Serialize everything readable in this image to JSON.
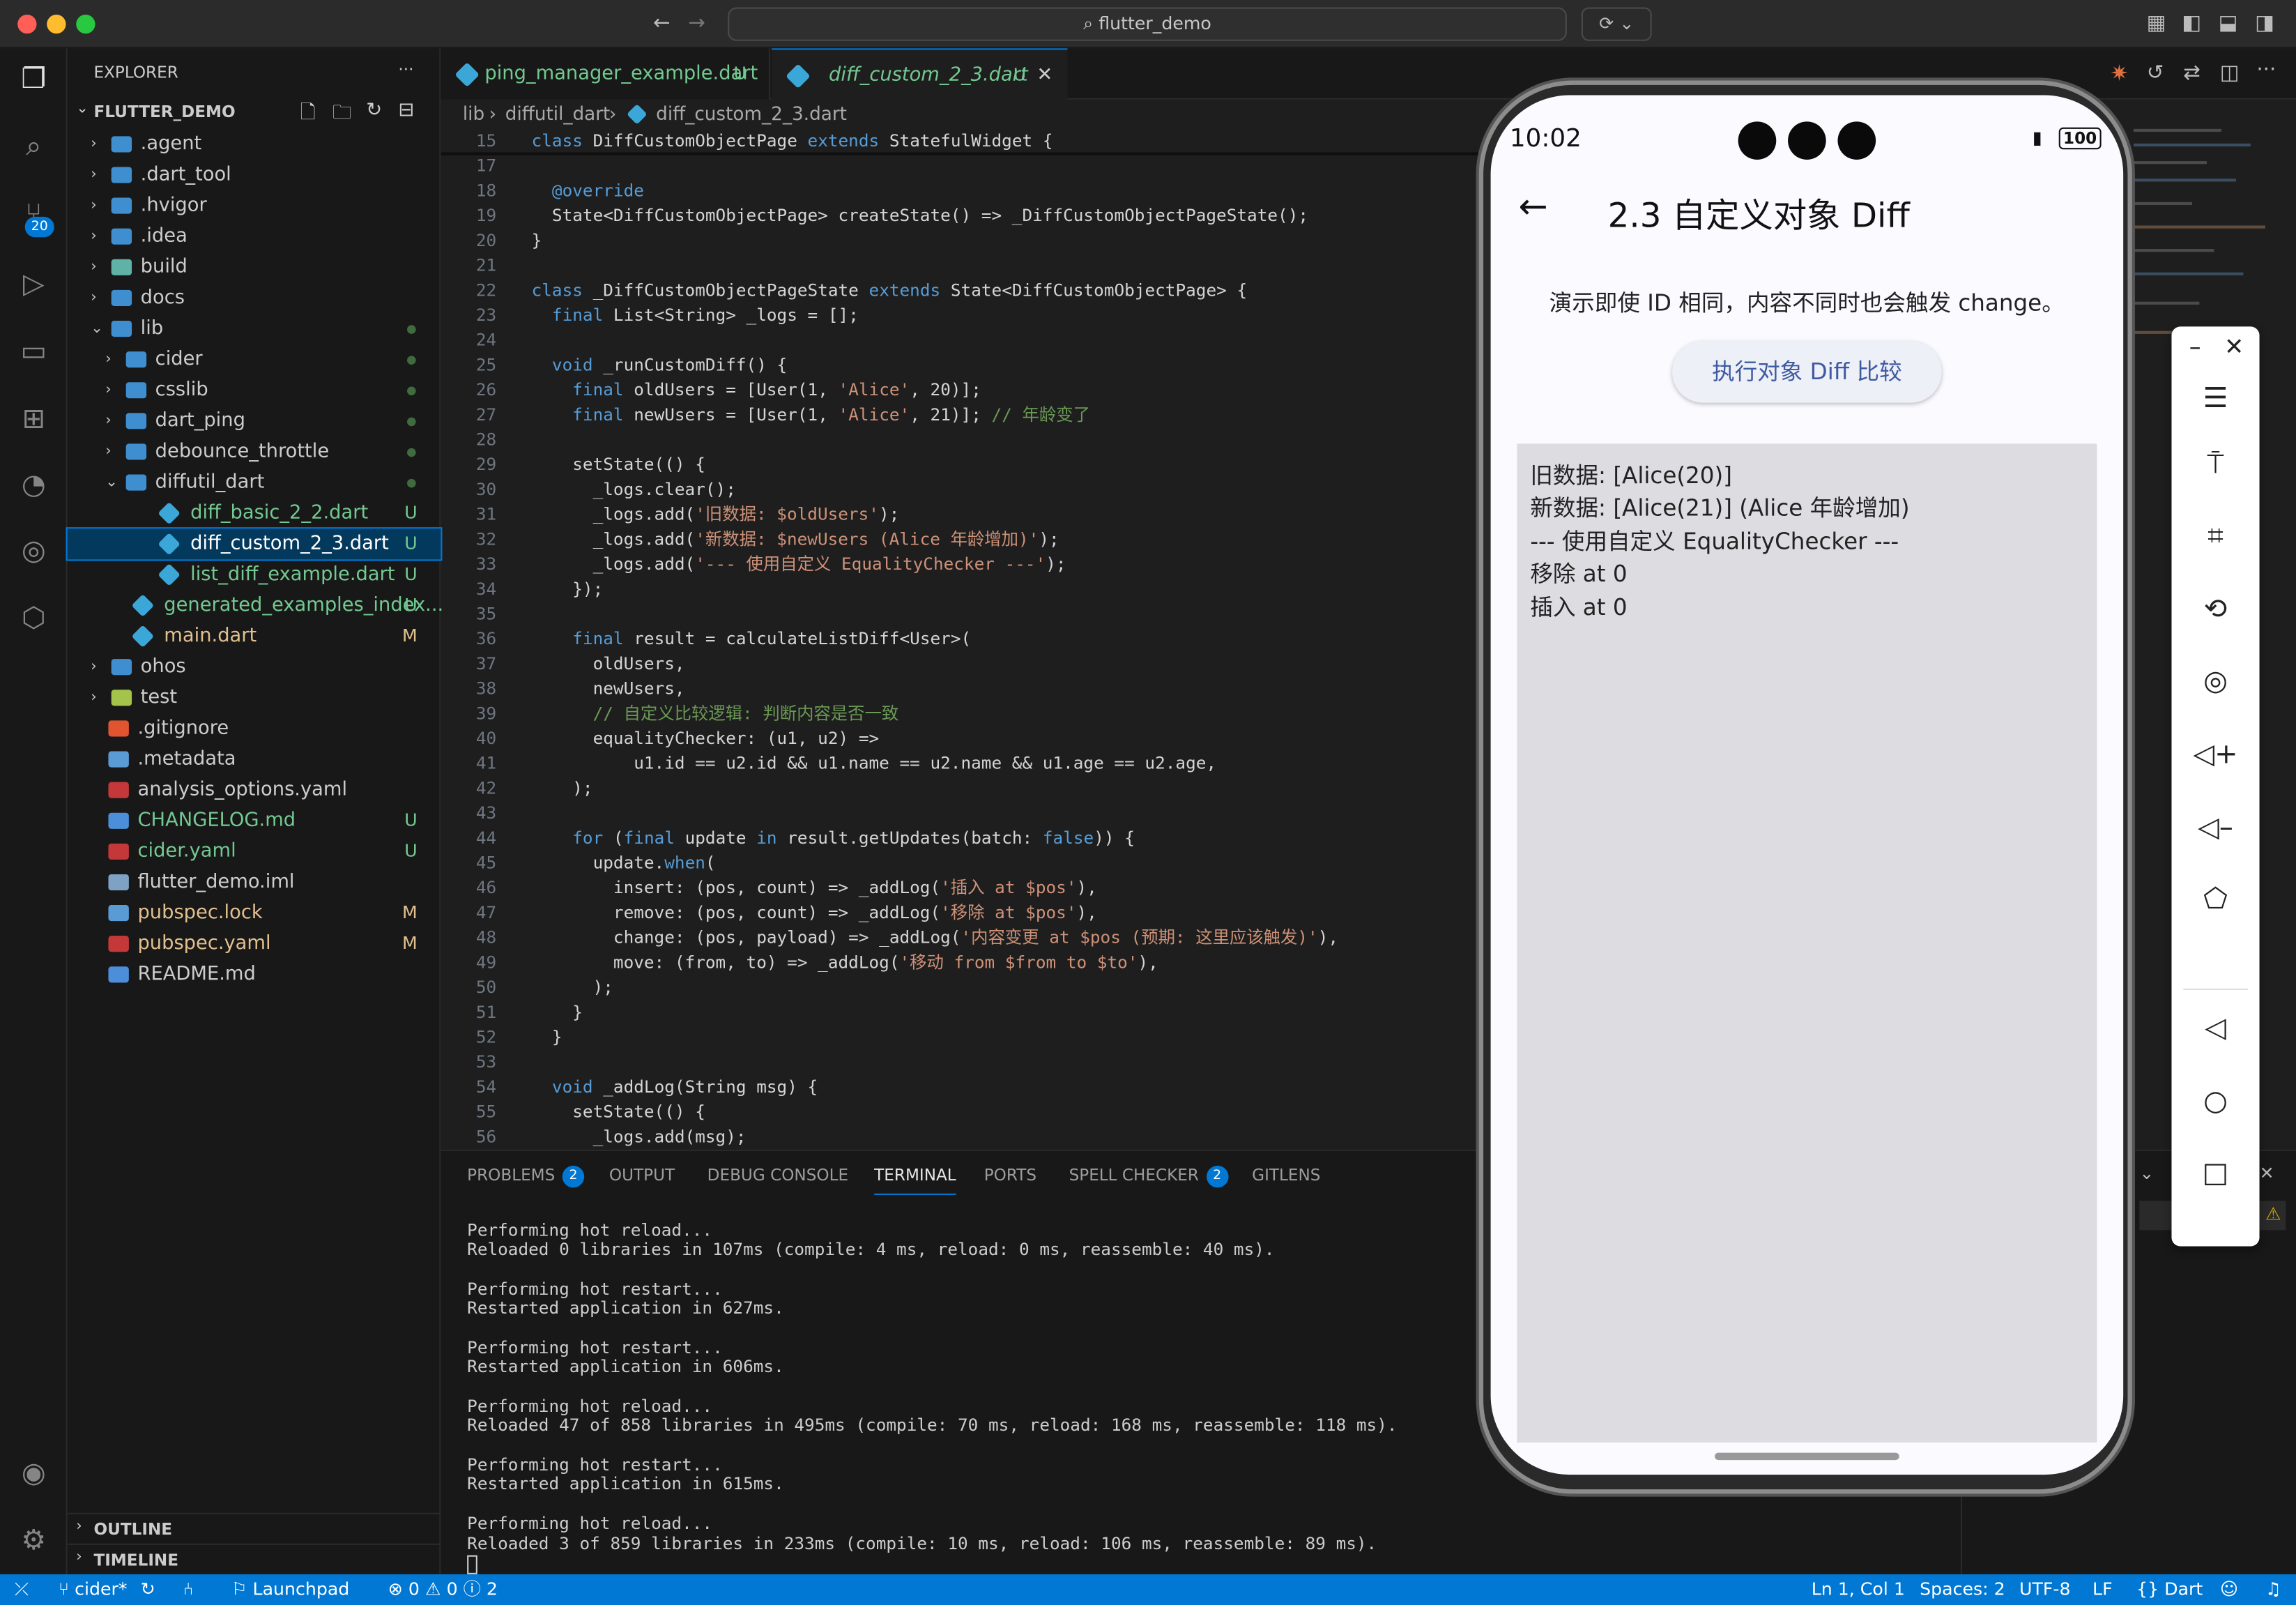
{
  "window": {
    "search_text": "flutter_demo"
  },
  "activity_bar": {
    "scm_badge": "20"
  },
  "explorer": {
    "title": "EXPLORER",
    "more": "···",
    "project": "FLUTTER_DEMO",
    "items": [
      {
        "label": ".agent",
        "type": "folder",
        "depth": 0,
        "open": false,
        "status": "",
        "dot": false
      },
      {
        "label": ".dart_tool",
        "type": "folder",
        "depth": 0,
        "open": false,
        "status": "",
        "dot": false
      },
      {
        "label": ".hvigor",
        "type": "folder",
        "depth": 0,
        "open": false,
        "status": "",
        "dot": false
      },
      {
        "label": ".idea",
        "type": "folder",
        "depth": 0,
        "open": false,
        "status": "",
        "dot": false
      },
      {
        "label": "build",
        "type": "folder-special",
        "depth": 0,
        "open": false,
        "status": "",
        "dot": false
      },
      {
        "label": "docs",
        "type": "folder",
        "depth": 0,
        "open": false,
        "status": "",
        "dot": false
      },
      {
        "label": "lib",
        "type": "folder",
        "depth": 0,
        "open": true,
        "status": "",
        "dot": true
      },
      {
        "label": "cider",
        "type": "folder",
        "depth": 1,
        "open": false,
        "status": "",
        "dot": true
      },
      {
        "label": "csslib",
        "type": "folder",
        "depth": 1,
        "open": false,
        "status": "",
        "dot": true
      },
      {
        "label": "dart_ping",
        "type": "folder",
        "depth": 1,
        "open": false,
        "status": "",
        "dot": true
      },
      {
        "label": "debounce_throttle",
        "type": "folder",
        "depth": 1,
        "open": false,
        "status": "",
        "dot": true
      },
      {
        "label": "diffutil_dart",
        "type": "folder",
        "depth": 1,
        "open": true,
        "status": "",
        "dot": true
      },
      {
        "label": "diff_basic_2_2.dart",
        "type": "dart",
        "depth": 2,
        "open": false,
        "status": "U",
        "dot": false
      },
      {
        "label": "diff_custom_2_3.dart",
        "type": "dart",
        "depth": 2,
        "open": false,
        "status": "U",
        "dot": false,
        "selected": true
      },
      {
        "label": "list_diff_example.dart",
        "type": "dart",
        "depth": 2,
        "open": false,
        "status": "U",
        "dot": false
      },
      {
        "label": "generated_examples_index...",
        "type": "dart",
        "depth": 1,
        "open": false,
        "status": "U",
        "dot": false
      },
      {
        "label": "main.dart",
        "type": "dart",
        "depth": 1,
        "open": false,
        "status": "M",
        "dot": false
      },
      {
        "label": "ohos",
        "type": "folder",
        "depth": 0,
        "open": false,
        "status": "",
        "dot": false
      },
      {
        "label": "test",
        "type": "folder-test",
        "depth": 0,
        "open": false,
        "status": "",
        "dot": false
      },
      {
        "label": ".gitignore",
        "type": "git",
        "depth": 0,
        "open": false,
        "status": "",
        "dot": false
      },
      {
        "label": ".metadata",
        "type": "file",
        "depth": 0,
        "open": false,
        "status": "",
        "dot": false
      },
      {
        "label": "analysis_options.yaml",
        "type": "yaml",
        "depth": 0,
        "open": false,
        "status": "",
        "dot": false
      },
      {
        "label": "CHANGELOG.md",
        "type": "md",
        "depth": 0,
        "open": false,
        "status": "U",
        "dot": false
      },
      {
        "label": "cider.yaml",
        "type": "yaml",
        "depth": 0,
        "open": false,
        "status": "U",
        "dot": false
      },
      {
        "label": "flutter_demo.iml",
        "type": "xml",
        "depth": 0,
        "open": false,
        "status": "",
        "dot": false
      },
      {
        "label": "pubspec.lock",
        "type": "file",
        "depth": 0,
        "open": false,
        "status": "M",
        "dot": false
      },
      {
        "label": "pubspec.yaml",
        "type": "yaml",
        "depth": 0,
        "open": false,
        "status": "M",
        "dot": false
      },
      {
        "label": "README.md",
        "type": "md",
        "depth": 0,
        "open": false,
        "status": "",
        "dot": false
      }
    ],
    "outline": "OUTLINE",
    "timeline": "TIMELINE"
  },
  "tabs": [
    {
      "label": "ping_manager_example.dart",
      "status": "U",
      "active": false
    },
    {
      "label": "diff_custom_2_3.dart",
      "status": "U",
      "active": true
    }
  ],
  "breadcrumb": [
    "lib",
    "diffutil_dart",
    "diff_custom_2_3.dart"
  ],
  "code": [
    {
      "n": "15",
      "t": "class DiffCustomObjectPage extends StatefulWidget {"
    },
    {
      "n": "17",
      "t": ""
    },
    {
      "n": "18",
      "t": "  @override"
    },
    {
      "n": "19",
      "t": "  State<DiffCustomObjectPage> createState() => _DiffCustomObjectPageState();"
    },
    {
      "n": "20",
      "t": "}"
    },
    {
      "n": "21",
      "t": ""
    },
    {
      "n": "22",
      "t": "class _DiffCustomObjectPageState extends State<DiffCustomObjectPage> {"
    },
    {
      "n": "23",
      "t": "  final List<String> _logs = [];"
    },
    {
      "n": "24",
      "t": ""
    },
    {
      "n": "25",
      "t": "  void _runCustomDiff() {"
    },
    {
      "n": "26",
      "t": "    final oldUsers = [User(1, 'Alice', 20)];"
    },
    {
      "n": "27",
      "t": "    final newUsers = [User(1, 'Alice', 21)]; // 年龄变了"
    },
    {
      "n": "28",
      "t": ""
    },
    {
      "n": "29",
      "t": "    setState(() {"
    },
    {
      "n": "30",
      "t": "      _logs.clear();"
    },
    {
      "n": "31",
      "t": "      _logs.add('旧数据: $oldUsers');"
    },
    {
      "n": "32",
      "t": "      _logs.add('新数据: $newUsers (Alice 年龄增加)');"
    },
    {
      "n": "33",
      "t": "      _logs.add('--- 使用自定义 EqualityChecker ---');"
    },
    {
      "n": "34",
      "t": "    });"
    },
    {
      "n": "35",
      "t": ""
    },
    {
      "n": "36",
      "t": "    final result = calculateListDiff<User>("
    },
    {
      "n": "37",
      "t": "      oldUsers,"
    },
    {
      "n": "38",
      "t": "      newUsers,"
    },
    {
      "n": "39",
      "t": "      // 自定义比较逻辑: 判断内容是否一致"
    },
    {
      "n": "40",
      "t": "      equalityChecker: (u1, u2) =>"
    },
    {
      "n": "41",
      "t": "          u1.id == u2.id && u1.name == u2.name && u1.age == u2.age,"
    },
    {
      "n": "42",
      "t": "    );"
    },
    {
      "n": "43",
      "t": ""
    },
    {
      "n": "44",
      "t": "    for (final update in result.getUpdates(batch: false)) {"
    },
    {
      "n": "45",
      "t": "      update.when("
    },
    {
      "n": "46",
      "t": "        insert: (pos, count) => _addLog('插入 at $pos'),"
    },
    {
      "n": "47",
      "t": "        remove: (pos, count) => _addLog('移除 at $pos'),"
    },
    {
      "n": "48",
      "t": "        change: (pos, payload) => _addLog('内容变更 at $pos (预期: 这里应该触发)'),"
    },
    {
      "n": "49",
      "t": "        move: (from, to) => _addLog('移动 from $from to $to'),"
    },
    {
      "n": "50",
      "t": "      );"
    },
    {
      "n": "51",
      "t": "    }"
    },
    {
      "n": "52",
      "t": "  }"
    },
    {
      "n": "53",
      "t": ""
    },
    {
      "n": "54",
      "t": "  void _addLog(String msg) {"
    },
    {
      "n": "55",
      "t": "    setState(() {"
    },
    {
      "n": "56",
      "t": "      _logs.add(msg);"
    }
  ],
  "panel": {
    "tabs": [
      {
        "label": "PROBLEMS",
        "badge": "2",
        "active": false
      },
      {
        "label": "OUTPUT",
        "badge": "",
        "active": false
      },
      {
        "label": "DEBUG CONSOLE",
        "badge": "",
        "active": false
      },
      {
        "label": "TERMINAL",
        "badge": "",
        "active": true
      },
      {
        "label": "PORTS",
        "badge": "",
        "active": false
      },
      {
        "label": "SPELL CHECKER",
        "badge": "2",
        "active": false
      },
      {
        "label": "GITLENS",
        "badge": "",
        "active": false
      }
    ],
    "terminal": "Performing hot reload...\nReloaded 0 libraries in 107ms (compile: 4 ms, reload: 0 ms, reassemble: 40 ms).\n\nPerforming hot restart...\nRestarted application in 627ms.\n\nPerforming hot restart...\nRestarted application in 606ms.\n\nPerforming hot reload...\nReloaded 47 of 858 libraries in 495ms (compile: 70 ms, reload: 168 ms, reassemble: 118 ms).\n\nPerforming hot restart...\nRestarted application in 615ms.\n\nPerforming hot reload...\nReloaded 3 of 859 libraries in 233ms (compile: 10 ms, reload: 106 ms, reassemble: 89 ms)."
  },
  "status_bar": {
    "branch": "cider*",
    "launchpad": "Launchpad",
    "errors": "0",
    "warnings": "0",
    "info": "2",
    "cursor": "Ln 1, Col 1",
    "spaces": "Spaces: 2",
    "encoding": "UTF-8",
    "eol": "LF",
    "language": "Dart"
  },
  "phone": {
    "time": "10:02",
    "battery": "100",
    "page_title": "2.3 自定义对象 Diff",
    "description": "演示即使 ID 相同，内容不同时也会触发 change。",
    "button": "执行对象 Diff 比较",
    "log_lines": [
      "旧数据: [Alice(20)]",
      "新数据: [Alice(21)] (Alice 年龄增加)",
      "--- 使用自定义 EqualityChecker ---",
      "移除 at 0",
      "插入 at 0"
    ]
  },
  "colors": {
    "accent": "#0078d4",
    "editor_bg": "#1e1e1e",
    "sidebar_bg": "#181818",
    "keyword": "#569cd6",
    "type": "#4ec9b0",
    "string": "#ce9178",
    "comment": "#6a9955",
    "status_u": "#73c991",
    "status_m": "#e2c08d"
  }
}
